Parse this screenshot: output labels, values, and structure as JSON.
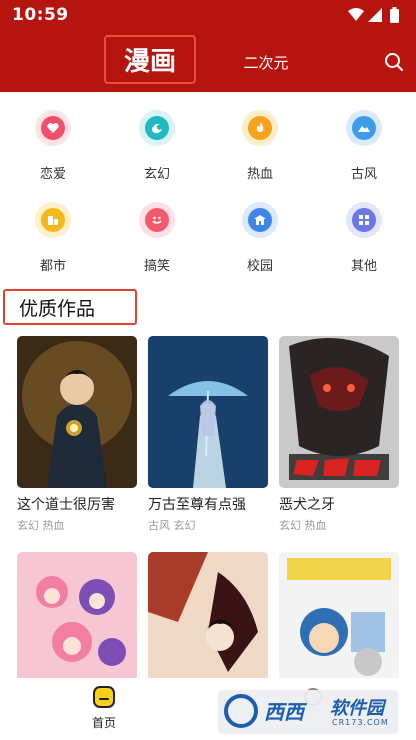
{
  "status_bar": {
    "time": "10:59"
  },
  "header": {
    "tabs": [
      {
        "label": "漫画",
        "active": true
      },
      {
        "label": "二次元",
        "active": false
      }
    ],
    "search_icon": "search-icon",
    "background": "#b5150e"
  },
  "categories": [
    {
      "label": "恋爱",
      "icon": "heart-icon",
      "color": "#ef4f6a"
    },
    {
      "label": "玄幻",
      "icon": "swirl-icon",
      "color": "#20b9c4"
    },
    {
      "label": "热血",
      "icon": "flame-icon",
      "color": "#f7a21b"
    },
    {
      "label": "古风",
      "icon": "mountain-icon",
      "color": "#3d9de8"
    },
    {
      "label": "都市",
      "icon": "building-icon",
      "color": "#f4b81d"
    },
    {
      "label": "搞笑",
      "icon": "smile-icon",
      "color": "#f25a6e"
    },
    {
      "label": "校园",
      "icon": "school-icon",
      "color": "#3d86e8"
    },
    {
      "label": "其他",
      "icon": "grid-icon",
      "color": "#6a78e6"
    }
  ],
  "section": {
    "title": "优质作品"
  },
  "works": [
    {
      "title": "这个道士很厉害",
      "tags": "玄幻 热血",
      "palette": [
        "#3b2a16",
        "#7a5a2a",
        "#c9a233"
      ]
    },
    {
      "title": "万古至尊有点强",
      "tags": "古风 玄幻",
      "palette": [
        "#0c1f3a",
        "#2a68a8",
        "#8fd0f2"
      ]
    },
    {
      "title": "恶犬之牙",
      "tags": "玄幻 热血",
      "palette": [
        "#2a2424",
        "#6b1b1b",
        "#c9c9c9"
      ]
    },
    {
      "title": "",
      "tags": "",
      "palette": [
        "#f6c6d2",
        "#7d4fb6",
        "#f27fa3"
      ]
    },
    {
      "title": "",
      "tags": "",
      "palette": [
        "#3a1414",
        "#a93b2a",
        "#efd9c4"
      ]
    },
    {
      "title": "",
      "tags": "",
      "palette": [
        "#f3f3f3",
        "#2f6fb5",
        "#f0d34a"
      ]
    }
  ],
  "bottom_nav": {
    "items": [
      {
        "label": "首页",
        "icon": "home-icon",
        "active": true
      }
    ]
  },
  "watermark": {
    "text1": "西西",
    "text2": "软件园",
    "url": "CR173.COM"
  }
}
